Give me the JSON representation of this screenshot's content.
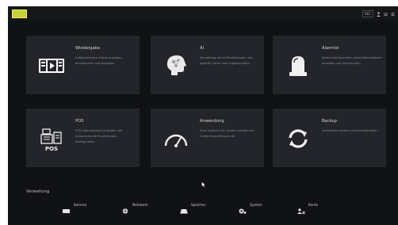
{
  "topbar": {
    "logo_text": "",
    "rec_label": "REC"
  },
  "cards": [
    {
      "title": "Wiedergabe",
      "desc": "Aufgezeichnete Videos anzeigen, durchsuchen und abspielen.",
      "icon": "playback-icon"
    },
    {
      "title": "AI",
      "desc": "Verwaltung von AI-Einstellungen und gezielte Suche nach Eigenschaften.",
      "icon": "ai-head-icon"
    },
    {
      "title": "Alarmlst",
      "desc": "Alarme konfigurieren, Alarminformationen anzeigen und durchsuchen.",
      "icon": "alarm-light-icon"
    },
    {
      "title": "POS",
      "desc": "POS-Informationen anzeigen und entsprechende Einstellungen konfigurieren.",
      "icon": "pos-icon"
    },
    {
      "title": "Anwendung",
      "desc": "View System Info, System update and Config Import/Export etc.",
      "icon": "gauge-icon"
    },
    {
      "title": "Backup",
      "desc": "Aufnahmen sichern und herunterladen.",
      "icon": "backup-icon"
    }
  ],
  "management": {
    "label": "Verwaltung",
    "items": [
      {
        "label": "Kamera",
        "icon": "camera-icon"
      },
      {
        "label": "Netzwerk",
        "icon": "network-icon"
      },
      {
        "label": "Speicher",
        "icon": "storage-icon"
      },
      {
        "label": "System",
        "icon": "system-icon"
      },
      {
        "label": "Konto",
        "icon": "account-icon"
      }
    ]
  },
  "colors": {
    "background": "#111215",
    "card": "#23252a",
    "title": "#d7d7d7",
    "desc": "#8e9096",
    "logo": "#c9d13a"
  }
}
